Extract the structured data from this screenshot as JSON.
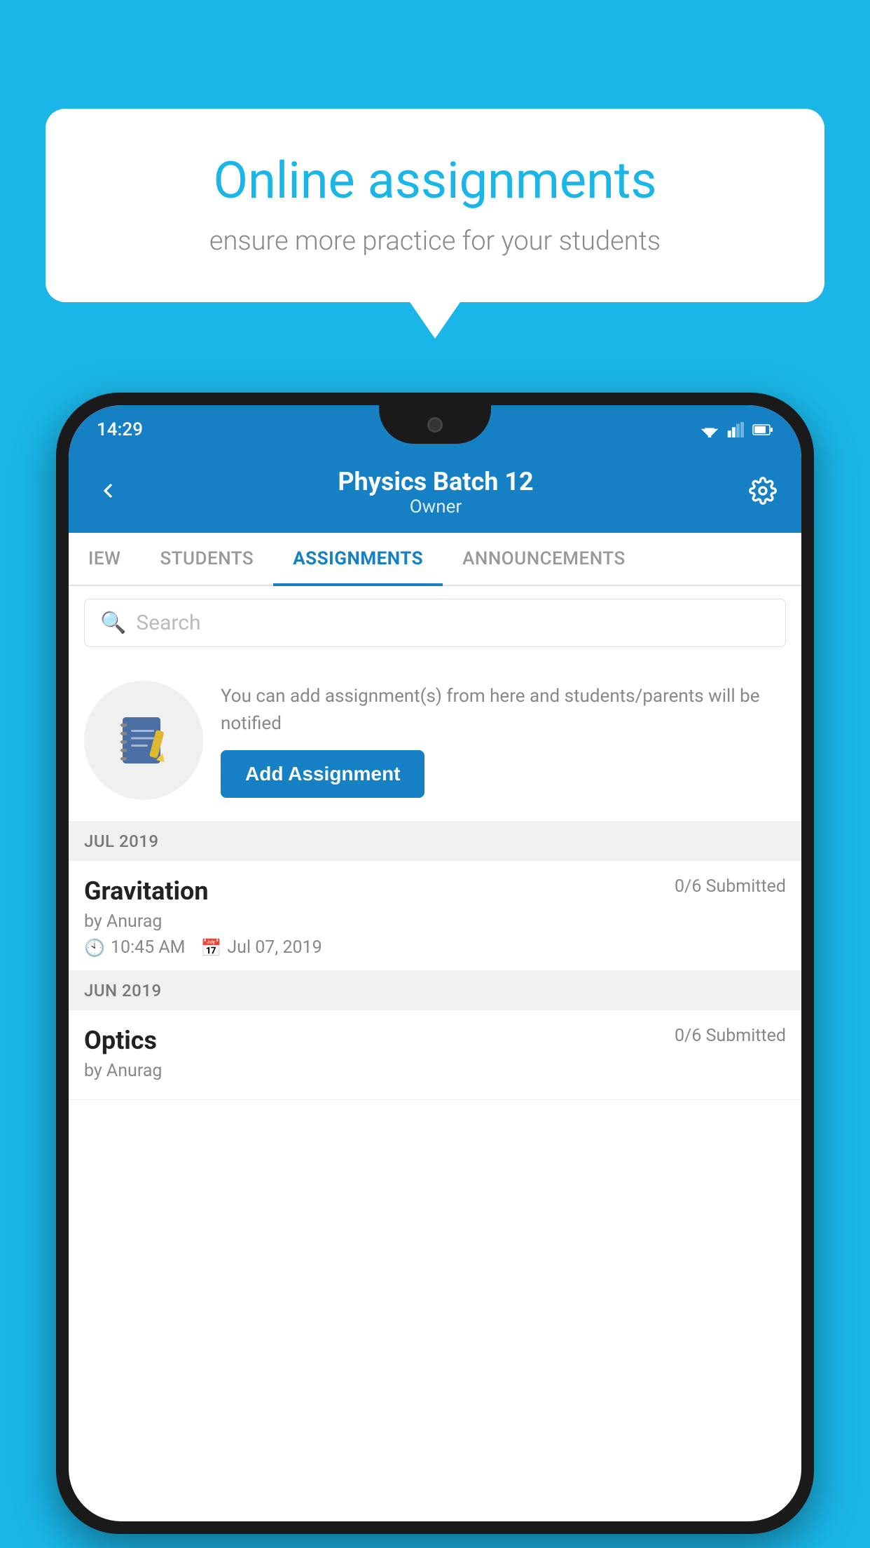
{
  "background_color": "#1ab6e8",
  "speech_bubble": {
    "title": "Online assignments",
    "subtitle": "ensure more practice for your students"
  },
  "status_bar": {
    "time": "14:29"
  },
  "header": {
    "title": "Physics Batch 12",
    "subtitle": "Owner"
  },
  "tabs": [
    {
      "label": "IEW",
      "active": false
    },
    {
      "label": "STUDENTS",
      "active": false
    },
    {
      "label": "ASSIGNMENTS",
      "active": true
    },
    {
      "label": "ANNOUNCEMENTS",
      "active": false
    }
  ],
  "search": {
    "placeholder": "Search"
  },
  "promo": {
    "text": "You can add assignment(s) from here and students/parents will be notified",
    "button_label": "Add Assignment"
  },
  "sections": [
    {
      "label": "JUL 2019",
      "items": [
        {
          "title": "Gravitation",
          "submitted": "0/6 Submitted",
          "by": "by Anurag",
          "time": "10:45 AM",
          "date": "Jul 07, 2019"
        }
      ]
    },
    {
      "label": "JUN 2019",
      "items": [
        {
          "title": "Optics",
          "submitted": "0/6 Submitted",
          "by": "by Anurag",
          "time": "",
          "date": ""
        }
      ]
    }
  ]
}
